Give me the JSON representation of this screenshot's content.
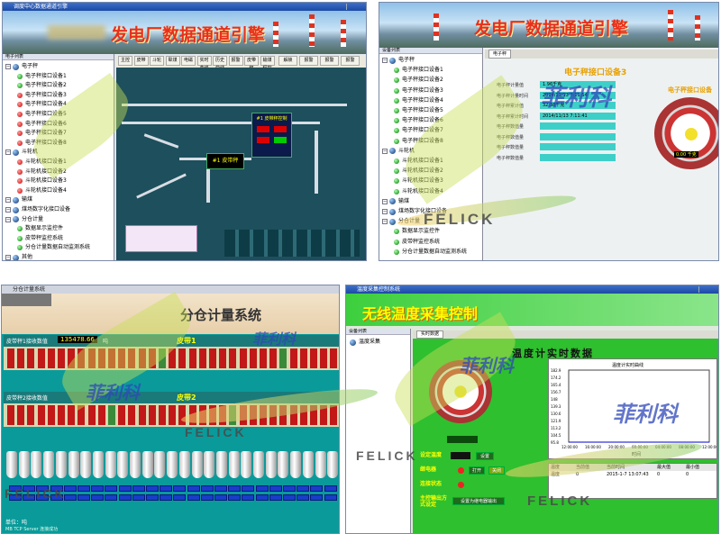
{
  "panel1": {
    "window_title": "调度中心数据通道引擎",
    "banner_title": "发电厂数据通道引擎",
    "tree_header": "电子列表",
    "tree": [
      {
        "label": "电子秤",
        "type": "group"
      },
      {
        "label": "电子秤接口设备1",
        "status": "green"
      },
      {
        "label": "电子秤接口设备2",
        "status": "green"
      },
      {
        "label": "电子秤接口设备3",
        "status": "red"
      },
      {
        "label": "电子秤接口设备4",
        "status": "red"
      },
      {
        "label": "电子秤接口设备5",
        "status": "red"
      },
      {
        "label": "电子秤接口设备6",
        "status": "red"
      },
      {
        "label": "电子秤接口设备7",
        "status": "red"
      },
      {
        "label": "电子秤接口设备8",
        "status": "red"
      },
      {
        "label": "斗轮机",
        "type": "group"
      },
      {
        "label": "斗轮机接口设备1",
        "status": "red"
      },
      {
        "label": "斗轮机接口设备2",
        "status": "red"
      },
      {
        "label": "斗轮机接口设备3",
        "status": "red"
      },
      {
        "label": "斗轮机接口设备4",
        "status": "red"
      },
      {
        "label": "输煤",
        "type": "group"
      },
      {
        "label": "煤场数字化接口设备",
        "type": "group"
      },
      {
        "label": "分仓计量",
        "type": "group"
      },
      {
        "label": "数据显示监控件",
        "status": "green"
      },
      {
        "label": "皮带秤监控系统",
        "status": "green"
      },
      {
        "label": "分仓计量数据自动监测系统",
        "status": "green"
      },
      {
        "label": "其他",
        "type": "group"
      }
    ],
    "toolbar": [
      "主控",
      "皮带",
      "斗轮",
      "犁煤",
      "电磁",
      "实时曲线",
      "历史曲线",
      "报警",
      "皮带秤",
      "输煤程控"
    ],
    "toolbar_right": [
      "解锁",
      "报警",
      "报警",
      "报警"
    ],
    "dash1_title": "#1 皮带秤控制",
    "dash2_title": "#1 皮带秤"
  },
  "panel2": {
    "banner_title": "发电厂数据通道引擎",
    "tree_header": "设备列表",
    "tab": "电子秤",
    "device_title": "电子秤接口设备3",
    "gauge_title": "电子秤接口设备",
    "gauge_unit": "0.00 千克",
    "fields": [
      {
        "label": "电子秤计量值",
        "value": "1.96千克"
      },
      {
        "label": "电子秤计量时间",
        "value": "2014/11/13 7:11:54"
      },
      {
        "label": "电子秤累计值",
        "value": "32.38千克"
      },
      {
        "label": "电子秤累计时间",
        "value": "2014/11/13 7:11:41"
      },
      {
        "label": "电子秤数值量",
        "value": ""
      },
      {
        "label": "电子秤数值量",
        "value": ""
      },
      {
        "label": "电子秤数值量",
        "value": ""
      },
      {
        "label": "电子秤数值量",
        "value": ""
      }
    ],
    "tree": [
      {
        "label": "电子秤",
        "type": "group"
      },
      {
        "label": "电子秤接口设备1",
        "status": "green"
      },
      {
        "label": "电子秤接口设备2",
        "status": "green"
      },
      {
        "label": "电子秤接口设备3",
        "status": "green"
      },
      {
        "label": "电子秤接口设备4",
        "status": "green"
      },
      {
        "label": "电子秤接口设备5",
        "status": "green"
      },
      {
        "label": "电子秤接口设备6",
        "status": "green"
      },
      {
        "label": "电子秤接口设备7",
        "status": "green"
      },
      {
        "label": "电子秤接口设备8",
        "status": "green"
      },
      {
        "label": "斗轮机",
        "type": "group"
      },
      {
        "label": "斗轮机接口设备1",
        "status": "green"
      },
      {
        "label": "斗轮机接口设备2",
        "status": "green"
      },
      {
        "label": "斗轮机接口设备3",
        "status": "green"
      },
      {
        "label": "斗轮机接口设备4",
        "status": "green"
      },
      {
        "label": "输煤",
        "type": "group"
      },
      {
        "label": "煤场数字化接口设备",
        "type": "group"
      },
      {
        "label": "分仓计量",
        "type": "group"
      },
      {
        "label": "数据显示监控件",
        "status": "green"
      },
      {
        "label": "皮带秤监控系统",
        "status": "green"
      },
      {
        "label": "分仓计量数据自动监测系统",
        "status": "green"
      }
    ]
  },
  "panel3": {
    "window_title": "分仓计量系统",
    "banner_title": "分仓计量系统",
    "row1_label": "皮带秤1接收数值",
    "row1_value": "135478.66",
    "row1_unit": "吨",
    "row1_section": "皮带1",
    "row2_label": "皮带秤2接收数值",
    "row2_section": "皮带2",
    "footer_unit": "单位：吨",
    "footer_status": "MB TCP Server 连接成功"
  },
  "panel4": {
    "window_title": "温度采集控制系统",
    "banner_title": "无线温度采集控制",
    "tree_header": "设备列表",
    "tree_item": "温度采集",
    "tab": "实时数据",
    "section_title": "温度计实时数据",
    "chart_title": "温度计实时曲线",
    "chart_xlabel": "时间",
    "fields": [
      {
        "label": "设定温度"
      },
      {
        "label": "继电器"
      },
      {
        "label": "连接状态"
      },
      {
        "label": "主控输出方式设定"
      }
    ],
    "buttons": [
      "设置",
      "打开",
      "关闭",
      "设置为继电器输出"
    ],
    "table_headers": [
      "温度",
      "当前值",
      "当前时间",
      "最大值",
      "最小值"
    ],
    "table_row": [
      "温度",
      "0",
      "2015-1-7 13:07:43",
      "0",
      "0"
    ]
  },
  "watermark": {
    "brand": "FELICK",
    "chinese": "菲利科"
  },
  "colors": {
    "banner_red": "#e8301c",
    "alarm_red": "#c00000",
    "ok_green": "#1f8a1f",
    "teal": "#3ed0c8",
    "panel3_bg": "#0a9a9a",
    "panel4_bg": "#2ec02e"
  },
  "chart_data": {
    "type": "line",
    "title": "温度计实时曲线",
    "xlabel": "时间",
    "ylabel": "",
    "x": [
      "12:00:00",
      "16:00:00",
      "20:00:00",
      "00:00:00",
      "04:00:00",
      "08:00:00",
      "12:00:00"
    ],
    "series": [
      {
        "values": [
          0,
          0,
          0,
          0,
          0,
          0,
          0
        ]
      }
    ],
    "ylim": [
      0,
      182.9
    ]
  }
}
